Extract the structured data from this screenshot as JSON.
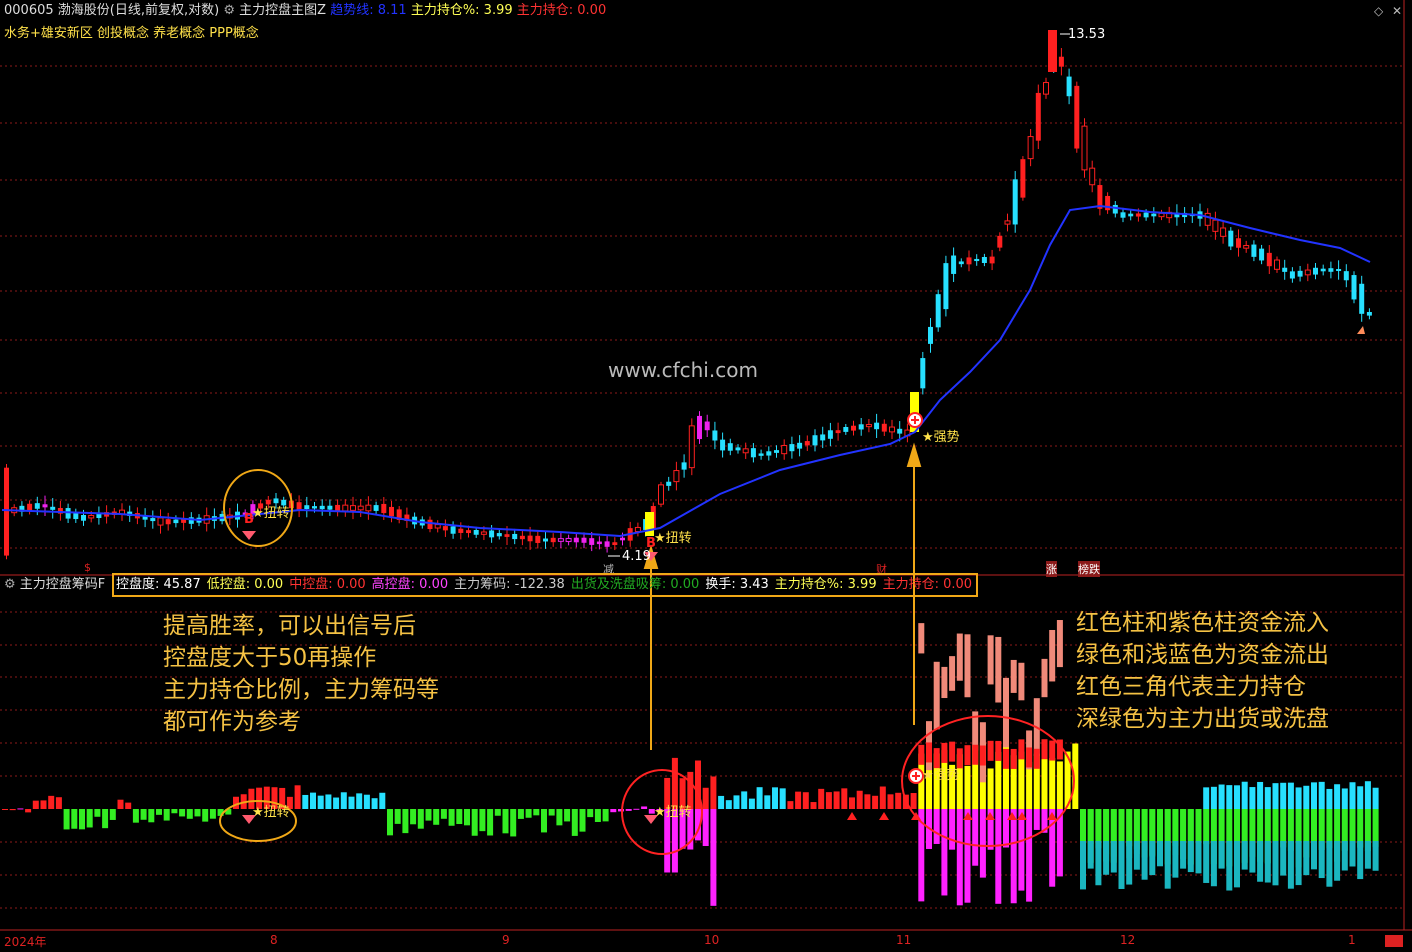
{
  "header": {
    "code": "000605",
    "name": "渤海股份",
    "mode": "(日线,前复权,对数)",
    "indicator": "主力控盘主图Z",
    "trend_label": "趋势线: 8.11",
    "hold_pct": "主力持仓%: 3.99",
    "hold": "主力持仓: 0.00"
  },
  "concepts": "水务+雄安新区 创投概念 养老概念 PPP概念",
  "watermark": "www.cfchi.com",
  "price_labels": {
    "high": "13.53",
    "low": "4.19"
  },
  "signals": {
    "twist1": "★扭转",
    "twist2": "★扭转",
    "strong": "★强势",
    "b1": "B",
    "b2": "B",
    "twist_sub1": "★扭转",
    "twist_sub2": "★扭转",
    "strong_sub": "★强势"
  },
  "event_marks": {
    "m1": "$",
    "m2": "减",
    "m3": "财",
    "m4": "涨",
    "m5": "榜跌"
  },
  "subpanel": {
    "title": "主力控盘筹码F",
    "fields": [
      {
        "label": "控盘度: 45.87",
        "color": "#ffffff"
      },
      {
        "label": "低控盘: 0.00",
        "color": "#ffff55"
      },
      {
        "label": "中控盘: 0.00",
        "color": "#ff3333"
      },
      {
        "label": "高控盘: 0.00",
        "color": "#ff44ff"
      },
      {
        "label": "主力筹码: -122.38",
        "color": "#cccccc"
      },
      {
        "label": "出货及洗盘吸筹: 0.00",
        "color": "#22aa22"
      },
      {
        "label": "换手: 3.43",
        "color": "#ffffff"
      },
      {
        "label": "主力持仓%: 3.99",
        "color": "#ffff55"
      },
      {
        "label": "主力持仓: 0.00",
        "color": "#ff3333"
      }
    ]
  },
  "annotations": {
    "left": [
      "提高胜率，可以出信号后",
      "控盘度大于50再操作",
      "主力持仓比例，主力筹码等",
      "都可作为参考"
    ],
    "right": [
      "红色柱和紫色柱资金流入",
      "绿色和浅蓝色为资金流出",
      "红色三角代表主力持仓",
      "深绿色为主力出货或洗盘"
    ]
  },
  "time_axis": {
    "year": "2024年",
    "months": [
      "8",
      "9",
      "10",
      "11",
      "12",
      "1"
    ]
  },
  "colors": {
    "up": "#ff2020",
    "down": "#27e0ff",
    "trend": "#2233ff",
    "outflow_green": "#33ee22",
    "deep_green": "#0d8f2a",
    "magenta": "#ff22ff",
    "yellow": "#ffff00",
    "annotation": "#f5c244"
  }
}
